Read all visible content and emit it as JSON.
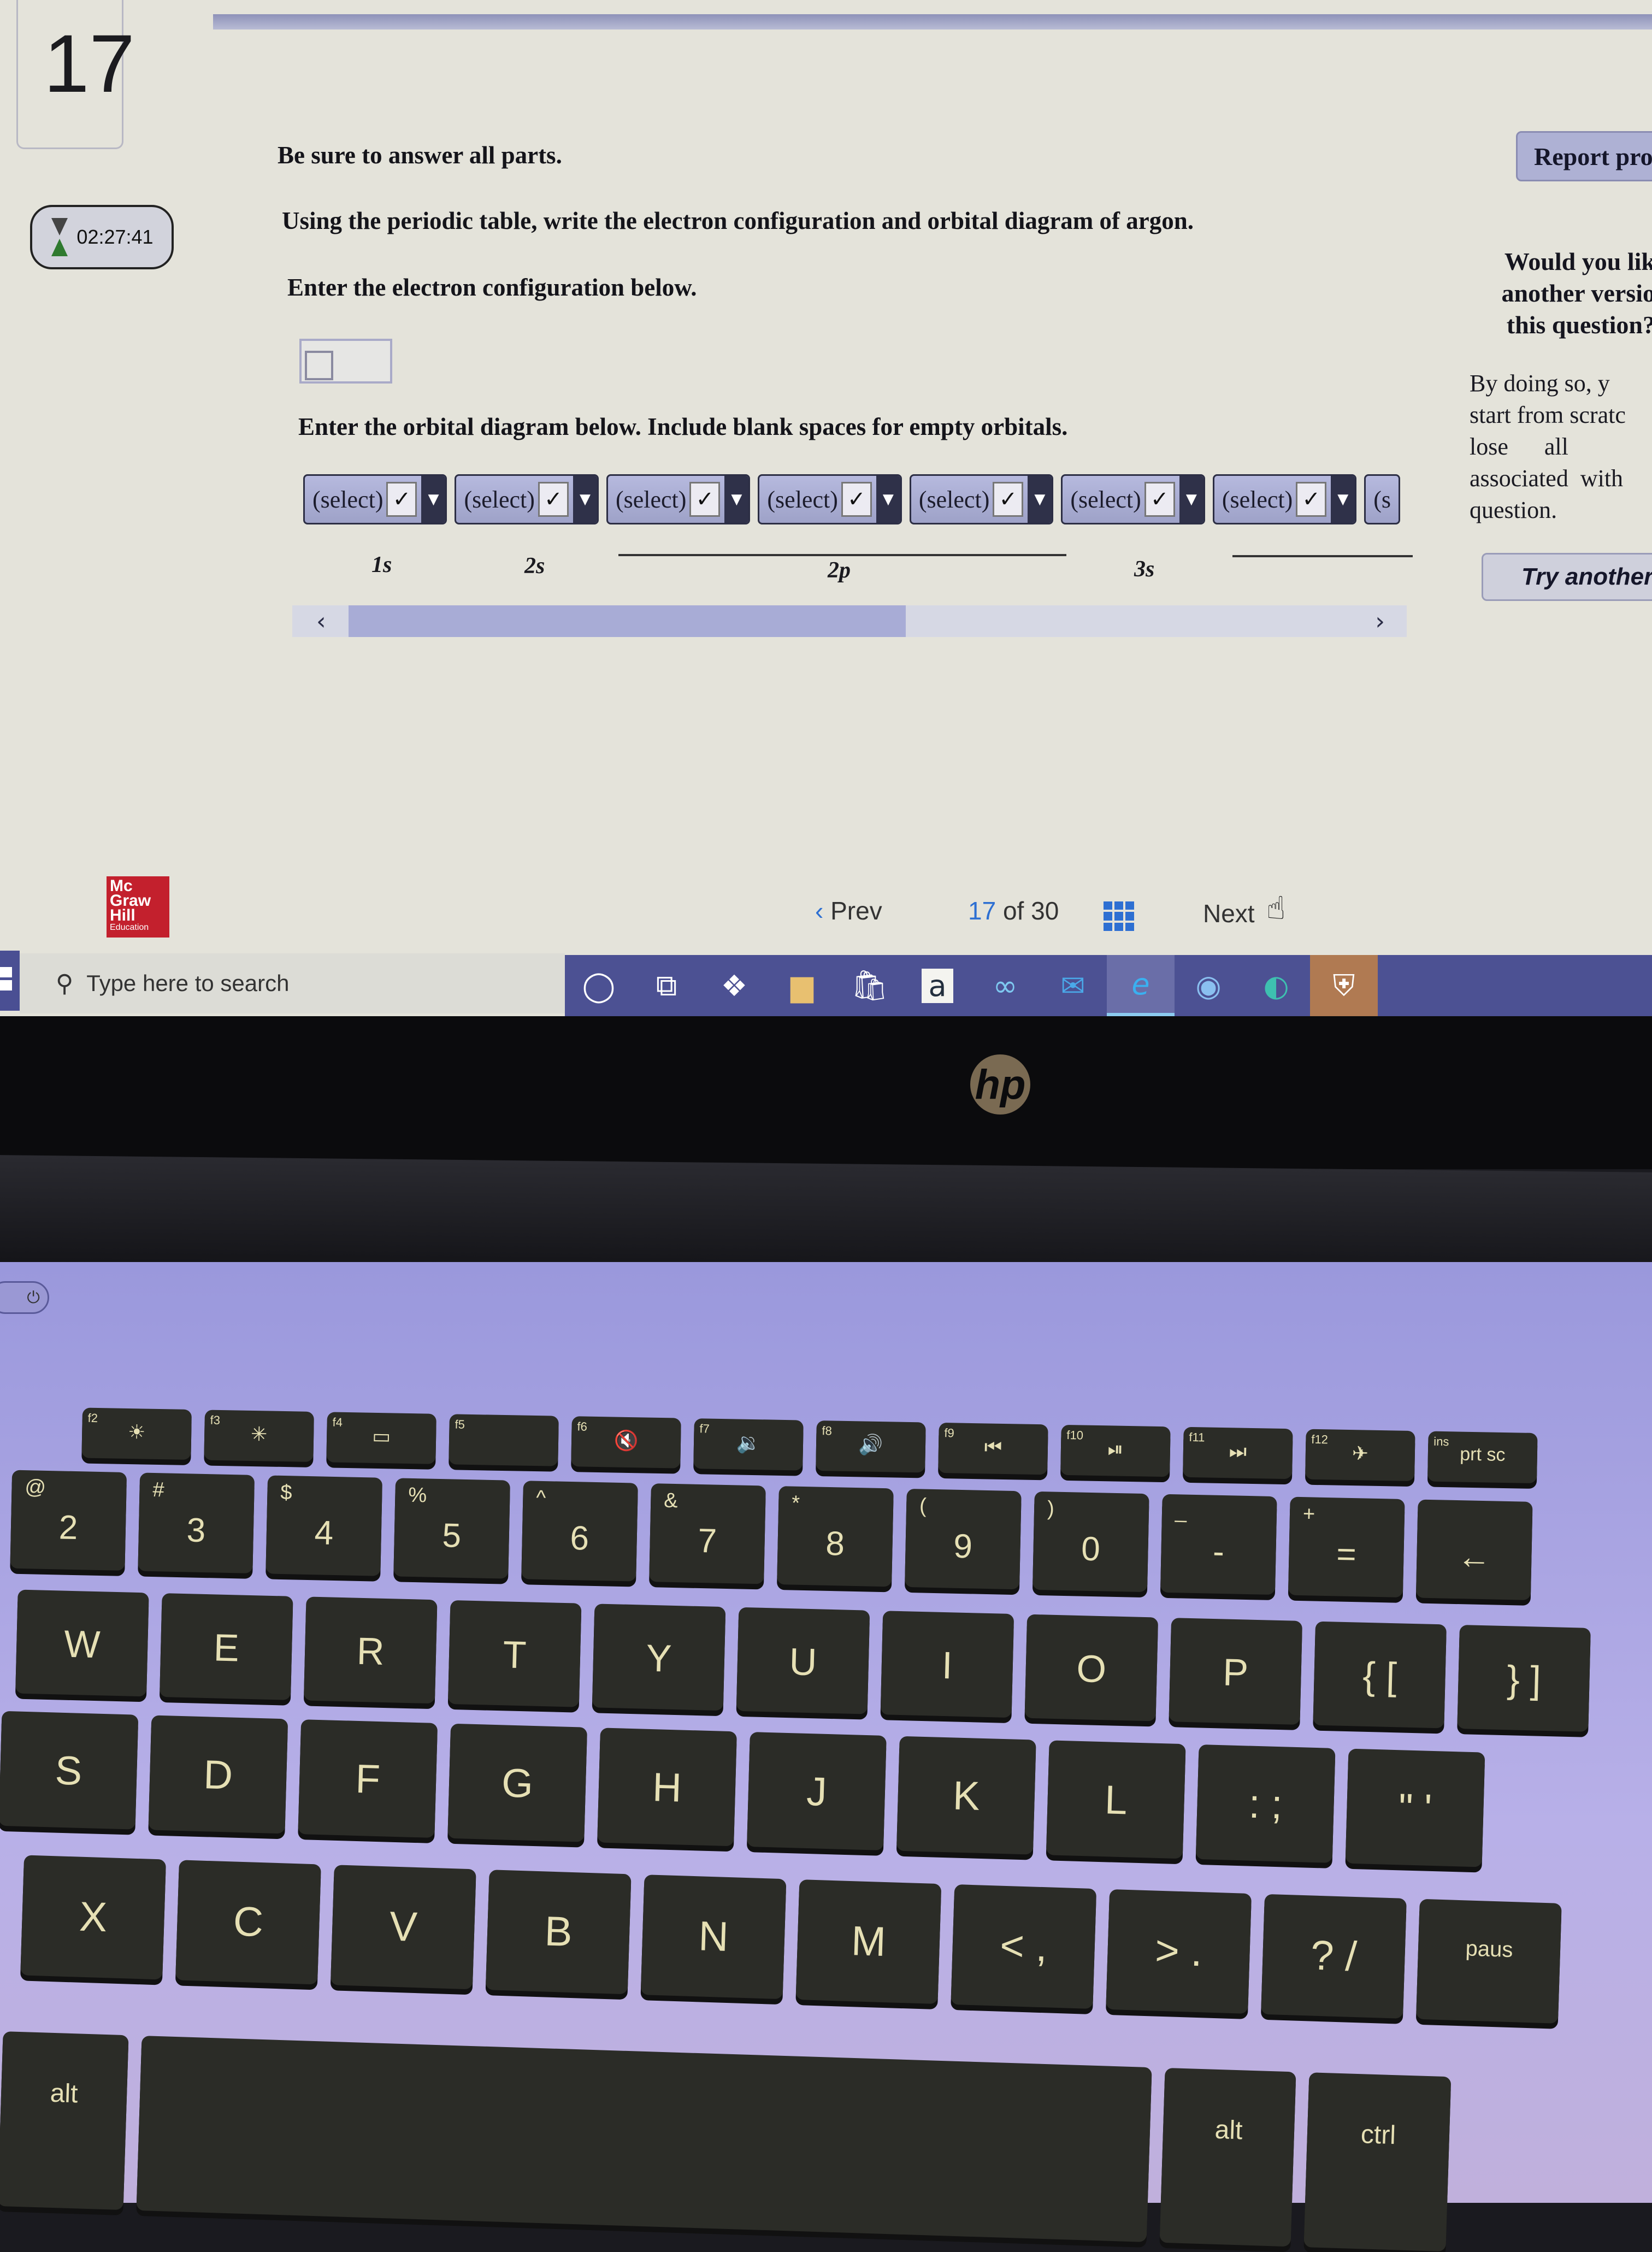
{
  "question": {
    "number": "17",
    "timer": "02:27:41",
    "instruction": "Be sure to answer all parts.",
    "prompt": "Using the periodic table, write the electron configuration and orbital diagram of argon.",
    "config_label": "Enter the electron configuration below.",
    "config_value": "",
    "orbital_label": "Enter the orbital diagram below. Include blank spaces for empty orbitals.",
    "orbital_selects": [
      {
        "value": "(select)"
      },
      {
        "value": "(select)"
      },
      {
        "value": "(select)"
      },
      {
        "value": "(select)"
      },
      {
        "value": "(select)"
      },
      {
        "value": "(select)"
      },
      {
        "value": "(select)"
      },
      {
        "value": "(s"
      }
    ],
    "orbital_labels": [
      "1s",
      "2s",
      "2p",
      "3s"
    ],
    "scroll_left": "‹",
    "scroll_right": "›",
    "scroll_position_fraction": 0.5
  },
  "sidebar": {
    "report_button": "Report pro",
    "retry_prompt": "Would you lik\nanother versio\nthis question?",
    "retry_note": "By doing so, y\nstart from scratc\nlose      all\nassociated  with\nquestion.",
    "try_button": "Try another"
  },
  "brand": {
    "logo_lines": [
      "Mc",
      "Graw",
      "Hill"
    ],
    "logo_sub": "Education",
    "color": "#c3202d"
  },
  "pagination": {
    "prev": "Prev",
    "current": "17",
    "of": "of",
    "total": "30",
    "next": "Next",
    "accent": "#2d6fd2"
  },
  "taskbar": {
    "search_placeholder": "Type here to search",
    "icons": [
      {
        "name": "cortana-icon",
        "glyph": "◯"
      },
      {
        "name": "task-view-icon",
        "glyph": "⧉"
      },
      {
        "name": "dropbox-icon",
        "glyph": "❖"
      },
      {
        "name": "file-explorer-icon",
        "glyph": "▆"
      },
      {
        "name": "microsoft-store-icon",
        "glyph": "🛍"
      },
      {
        "name": "amazon-icon",
        "glyph": "a"
      },
      {
        "name": "infinity-app-icon",
        "glyph": "∞"
      },
      {
        "name": "mail-icon",
        "glyph": "✉"
      },
      {
        "name": "internet-explorer-icon",
        "glyph": "e"
      },
      {
        "name": "chrome-icon",
        "glyph": "◉"
      },
      {
        "name": "edge-icon",
        "glyph": "◐"
      },
      {
        "name": "security-shield-icon",
        "glyph": "⛨"
      }
    ]
  },
  "laptop": {
    "brand": "hp",
    "power_glyph": "⏻",
    "fn_row": [
      {
        "fn": "f2",
        "glyph": "☀"
      },
      {
        "fn": "f3",
        "glyph": "✳"
      },
      {
        "fn": "f4",
        "glyph": "▭"
      },
      {
        "fn": "f5",
        "glyph": ""
      },
      {
        "fn": "f6",
        "glyph": "🔇"
      },
      {
        "fn": "f7",
        "glyph": "🔉"
      },
      {
        "fn": "f8",
        "glyph": "🔊"
      },
      {
        "fn": "f9",
        "glyph": "⏮"
      },
      {
        "fn": "f10",
        "glyph": "⏯"
      },
      {
        "fn": "f11",
        "glyph": "⏭"
      },
      {
        "fn": "f12",
        "glyph": "✈"
      },
      {
        "fn": "ins",
        "glyph": "prt sc"
      }
    ],
    "num_row": [
      {
        "top": "@",
        "main": "2"
      },
      {
        "top": "#",
        "main": "3"
      },
      {
        "top": "$",
        "main": "4"
      },
      {
        "top": "%",
        "main": "5"
      },
      {
        "top": "^",
        "main": "6"
      },
      {
        "top": "&",
        "main": "7"
      },
      {
        "top": "*",
        "main": "8"
      },
      {
        "top": "(",
        "main": "9"
      },
      {
        "top": ")",
        "main": "0"
      },
      {
        "top": "_",
        "main": "-"
      },
      {
        "top": "+",
        "main": "="
      },
      {
        "top": "",
        "main": "←"
      }
    ],
    "qwerty_row": [
      "W",
      "E",
      "R",
      "T",
      "Y",
      "U",
      "I",
      "O",
      "P",
      "{ [",
      "} ]"
    ],
    "home_row": [
      "S",
      "D",
      "F",
      "G",
      "H",
      "J",
      "K",
      "L",
      ": ;",
      "\" '"
    ],
    "bottom_row": [
      "X",
      "C",
      "V",
      "B",
      "N",
      "M",
      "< ,",
      "> .",
      "? /",
      "paus"
    ],
    "space_row": [
      "alt",
      "",
      "alt",
      "ctrl"
    ]
  }
}
